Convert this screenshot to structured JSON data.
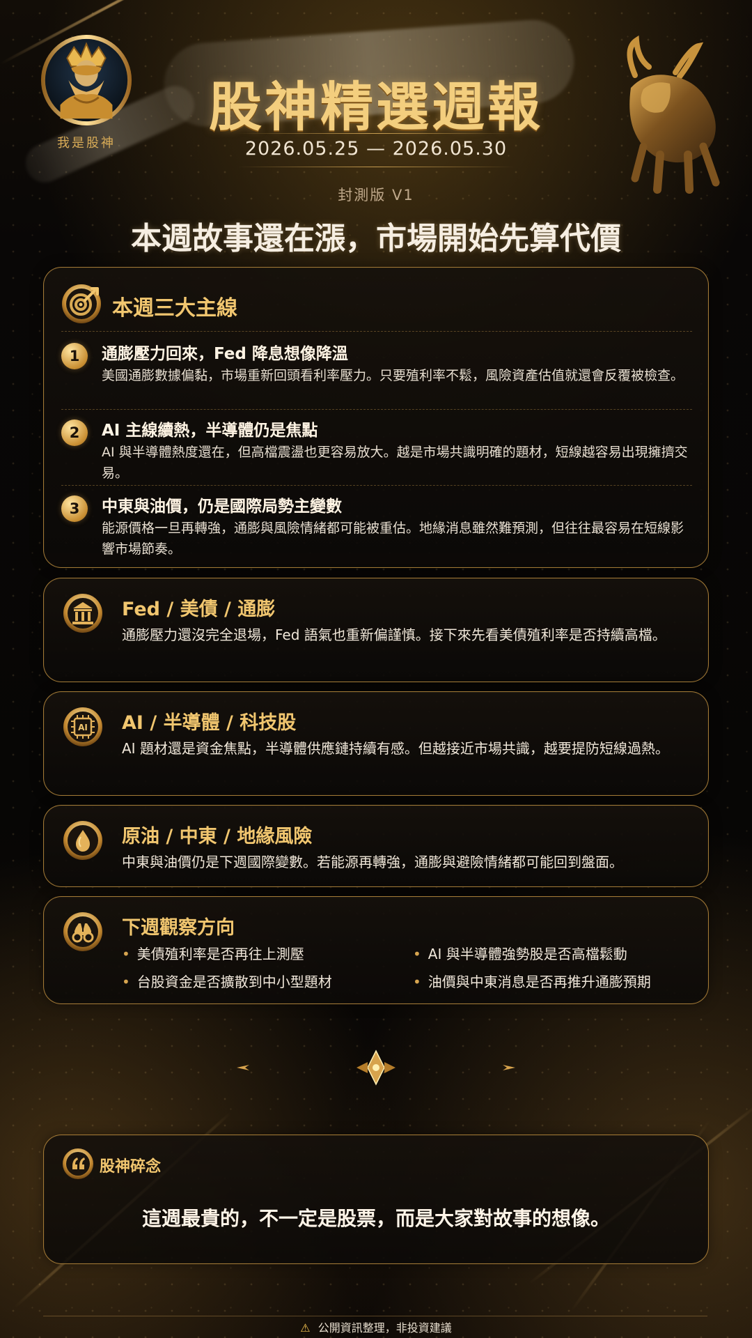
{
  "brand": {
    "logo_caption": "我是股神"
  },
  "header": {
    "title": "股神精選週報",
    "date_range": "2026.05.25 — 2026.05.30",
    "version": "封測版 V1",
    "headline": "本週故事還在漲，市場開始先算代價"
  },
  "main_themes": {
    "title": "本週三大主線",
    "icon": "target-icon",
    "items": [
      {
        "number": "1",
        "title": "通膨壓力回來，Fed 降息想像降溫",
        "description": "美國通膨數據偏黏，市場重新回頭看利率壓力。只要殖利率不鬆，風險資產估值就還會反覆被檢查。"
      },
      {
        "number": "2",
        "title": "AI 主線續熱，半導體仍是焦點",
        "description": "AI 與半導體熱度還在，但高檔震盪也更容易放大。越是市場共識明確的題材，短線越容易出現擁擠交易。"
      },
      {
        "number": "3",
        "title": "中東與油價，仍是國際局勢主變數",
        "description": "能源價格一旦再轉強，通膨與風險情緒都可能被重估。地緣消息雖然難預測，但往往最容易在短線影響市場節奏。"
      }
    ]
  },
  "sections": {
    "fed": {
      "title": "Fed / 美債 / 通膨",
      "body": "通膨壓力還沒完全退場，Fed 語氣也重新偏謹慎。接下來先看美債殖利率是否持續高檔。",
      "icon": "bank-icon"
    },
    "ai": {
      "title": "AI / 半導體 / 科技股",
      "body": "AI 題材還是資金焦點，半導體供應鏈持續有感。但越接近市場共識，越要提防短線過熱。",
      "icon": "ai-chip-icon",
      "icon_text": "AI"
    },
    "oil": {
      "title": "原油 / 中東 / 地緣風險",
      "body": "中東與油價仍是下週國際變數。若能源再轉強，通膨與避險情緒都可能回到盤面。",
      "icon": "oil-drop-icon"
    },
    "watch": {
      "title": "下週觀察方向",
      "icon": "binoculars-icon",
      "items": [
        "美債殖利率是否再往上測壓",
        "AI 與半導體強勢股是否高檔鬆動",
        "台股資金是否擴散到中小型題材",
        "油價與中東消息是否再推升通膨預期"
      ]
    }
  },
  "note": {
    "title": "股神碎念",
    "quote": "這週最貴的，不一定是股票，而是大家對故事的想像。",
    "icon": "quote-icon"
  },
  "footer": {
    "icon": "warning-icon",
    "text": "公開資訊整理，非投資建議"
  },
  "colors": {
    "gold": "#f1c66f",
    "dark_bg": "#050403",
    "text": "#efe6d2"
  }
}
